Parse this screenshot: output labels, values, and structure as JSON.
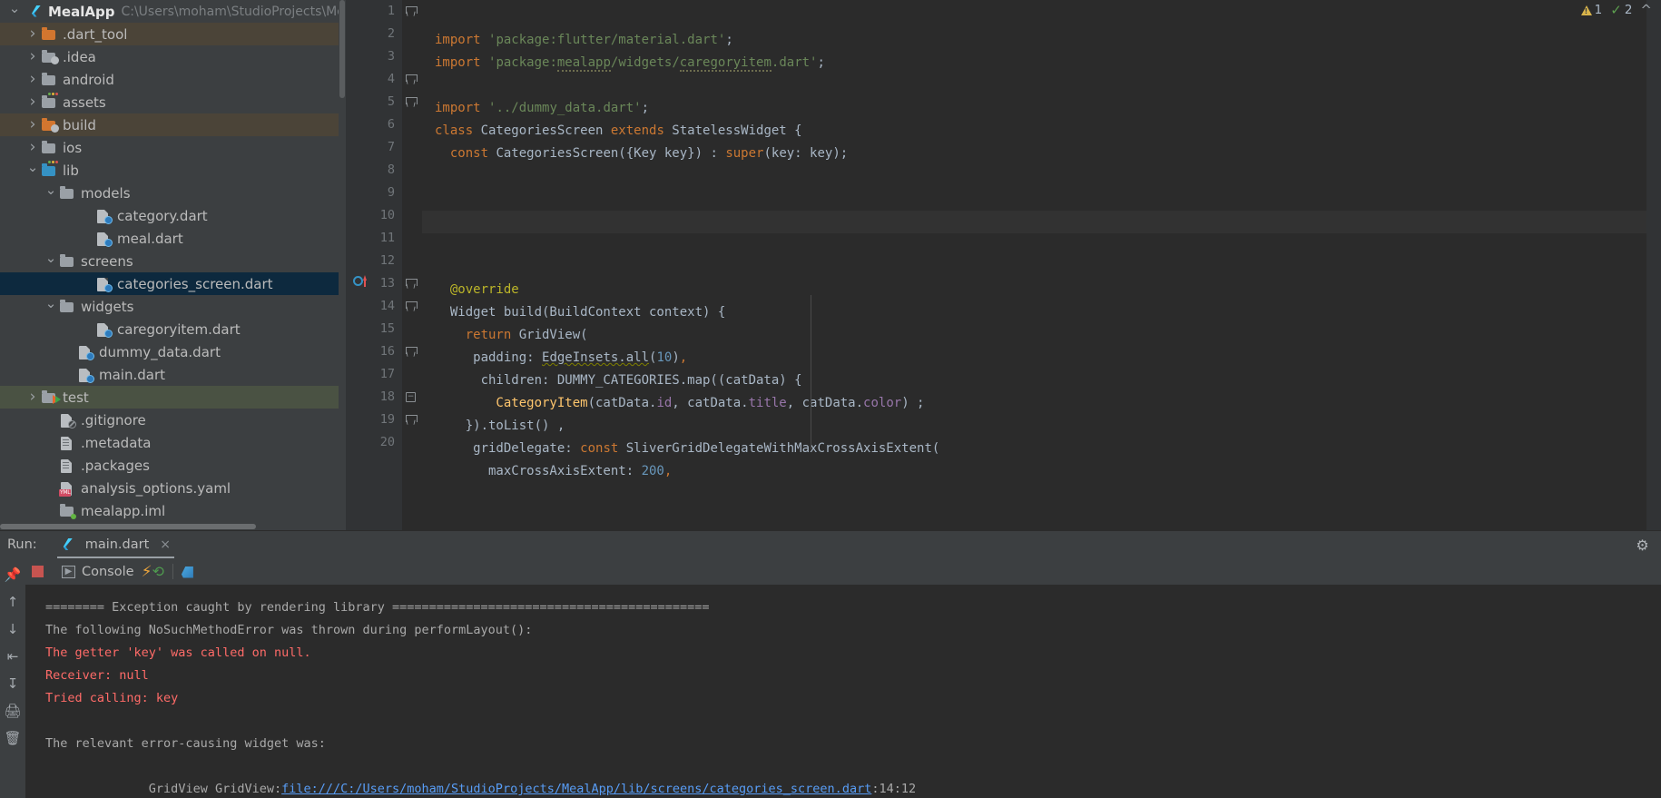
{
  "project": {
    "root_label": "MealApp",
    "root_path": "C:\\Users\\moham\\StudioProjects\\MealApp",
    "items": [
      {
        "label": ".dart_tool",
        "indent": 1,
        "arrow": "closed",
        "icon": "folder-orange",
        "row_style": "hl-orange"
      },
      {
        "label": ".idea",
        "indent": 1,
        "arrow": "closed",
        "icon": "folder-spin",
        "row_style": ""
      },
      {
        "label": "android",
        "indent": 1,
        "arrow": "closed",
        "icon": "folder-android",
        "row_style": ""
      },
      {
        "label": "assets",
        "indent": 1,
        "arrow": "closed",
        "icon": "folder-gray",
        "row_style": ""
      },
      {
        "label": "build",
        "indent": 1,
        "arrow": "closed",
        "icon": "folder-orange-spin",
        "row_style": "hl-orange"
      },
      {
        "label": "ios",
        "indent": 1,
        "arrow": "closed",
        "icon": "folder-android",
        "row_style": ""
      },
      {
        "label": "lib",
        "indent": 1,
        "arrow": "open",
        "icon": "folder-blue",
        "row_style": ""
      },
      {
        "label": "models",
        "indent": 2,
        "arrow": "open",
        "icon": "folder-gray",
        "row_style": ""
      },
      {
        "label": "category.dart",
        "indent": 4,
        "arrow": "none",
        "icon": "dart-file",
        "row_style": ""
      },
      {
        "label": "meal.dart",
        "indent": 4,
        "arrow": "none",
        "icon": "dart-file",
        "row_style": ""
      },
      {
        "label": "screens",
        "indent": 2,
        "arrow": "open",
        "icon": "folder-gray",
        "row_style": ""
      },
      {
        "label": "categories_screen.dart",
        "indent": 4,
        "arrow": "none",
        "icon": "dart-file",
        "row_style": "selected"
      },
      {
        "label": "widgets",
        "indent": 2,
        "arrow": "open",
        "icon": "folder-gray",
        "row_style": ""
      },
      {
        "label": "caregoryitem.dart",
        "indent": 4,
        "arrow": "none",
        "icon": "dart-file",
        "row_style": ""
      },
      {
        "label": "dummy_data.dart",
        "indent": 3,
        "arrow": "none",
        "icon": "dart-file",
        "row_style": ""
      },
      {
        "label": "main.dart",
        "indent": 3,
        "arrow": "none",
        "icon": "dart-file",
        "row_style": ""
      },
      {
        "label": "test",
        "indent": 1,
        "arrow": "closed",
        "icon": "folder-test",
        "row_style": "hl-green"
      },
      {
        "label": ".gitignore",
        "indent": 2,
        "arrow": "none",
        "icon": "gitignore-file",
        "row_style": ""
      },
      {
        "label": ".metadata",
        "indent": 2,
        "arrow": "none",
        "icon": "meta-file",
        "row_style": ""
      },
      {
        "label": ".packages",
        "indent": 2,
        "arrow": "none",
        "icon": "meta-file",
        "row_style": ""
      },
      {
        "label": "analysis_options.yaml",
        "indent": 2,
        "arrow": "none",
        "icon": "yaml-file",
        "row_style": ""
      },
      {
        "label": "mealapp.iml",
        "indent": 2,
        "arrow": "none",
        "icon": "iml-file",
        "row_style": ""
      }
    ]
  },
  "inspections": {
    "warning_count": "1",
    "ok_count": "2"
  },
  "editor": {
    "line_numbers": [
      "1",
      "2",
      "3",
      "4",
      "5",
      "6",
      "7",
      "8",
      "9",
      "10",
      "11",
      "12",
      "13",
      "14",
      "15",
      "16",
      "17",
      "18",
      "19",
      "20"
    ],
    "lines": [
      [
        {
          "t": "import ",
          "c": "kw"
        },
        {
          "t": "'package:flutter/material.dart'",
          "c": "str"
        },
        {
          "t": ";",
          "c": "def"
        }
      ],
      [
        {
          "t": "import ",
          "c": "kw"
        },
        {
          "t": "'package:",
          "c": "str"
        },
        {
          "t": "mealapp",
          "c": "str spell"
        },
        {
          "t": "/widgets/",
          "c": "str"
        },
        {
          "t": "caregoryitem",
          "c": "str spell"
        },
        {
          "t": ".dart'",
          "c": "str"
        },
        {
          "t": ";",
          "c": "def"
        }
      ],
      [],
      [
        {
          "t": "import ",
          "c": "kw"
        },
        {
          "t": "'../dummy_data.dart'",
          "c": "str"
        },
        {
          "t": ";",
          "c": "def"
        }
      ],
      [
        {
          "t": "class ",
          "c": "kw"
        },
        {
          "t": "CategoriesScreen",
          "c": "def"
        },
        {
          "t": " extends ",
          "c": "kw"
        },
        {
          "t": "StatelessWidget",
          "c": "def"
        },
        {
          "t": " {",
          "c": "def"
        }
      ],
      [
        {
          "t": "  const ",
          "c": "kw"
        },
        {
          "t": "CategoriesScreen({Key key}) : ",
          "c": "def"
        },
        {
          "t": "super",
          "c": "kw"
        },
        {
          "t": "(key: key);",
          "c": "def"
        }
      ],
      [],
      [],
      [],
      [],
      [],
      [
        {
          "t": "  @override",
          "c": "ann"
        }
      ],
      [
        {
          "t": "  Widget build(BuildContext context) {",
          "c": "def"
        }
      ],
      [
        {
          "t": "    return ",
          "c": "kw"
        },
        {
          "t": "GridView(",
          "c": "def"
        }
      ],
      [
        {
          "t": "     padding: ",
          "c": "def"
        },
        {
          "t": "EdgeInsets.all",
          "c": "def err-underline"
        },
        {
          "t": "(",
          "c": "def"
        },
        {
          "t": "10",
          "c": "num"
        },
        {
          "t": ")",
          "c": "def"
        },
        {
          "t": ",",
          "c": "red"
        }
      ],
      [
        {
          "t": "      children: DUMMY_CATEGORIES.map((catData) {",
          "c": "def"
        }
      ],
      [
        {
          "t": "        CategoryItem",
          "c": "fnc"
        },
        {
          "t": "(catData.",
          "c": "def"
        },
        {
          "t": "id",
          "c": "fld"
        },
        {
          "t": ", catData.",
          "c": "def"
        },
        {
          "t": "title",
          "c": "fld"
        },
        {
          "t": ", catData.",
          "c": "def"
        },
        {
          "t": "color",
          "c": "fld"
        },
        {
          "t": ") ;",
          "c": "def"
        }
      ],
      [
        {
          "t": "    }).toList() ,",
          "c": "def"
        }
      ],
      [
        {
          "t": "     gridDelegate: ",
          "c": "def"
        },
        {
          "t": "const ",
          "c": "kw"
        },
        {
          "t": "SliverGridDelegateWithMaxCrossAxisExtent(",
          "c": "def"
        }
      ],
      [
        {
          "t": "       maxCrossAxisExtent: ",
          "c": "def"
        },
        {
          "t": "200",
          "c": "num"
        },
        {
          "t": ",",
          "c": "red"
        }
      ]
    ]
  },
  "run_panel": {
    "run_label": "Run:",
    "tab_label": "main.dart",
    "tab_close": "×",
    "gear_icon": "gear-icon",
    "console_tab_label": "Console",
    "console_output": [
      {
        "text": "======== Exception caught by rendering library ===========================================",
        "style": "gray"
      },
      {
        "text": "The following NoSuchMethodError was thrown during performLayout():",
        "style": "gray"
      },
      {
        "text": "The getter 'key' was called on null.",
        "style": "red"
      },
      {
        "text": "Receiver: null",
        "style": "red"
      },
      {
        "text": "Tried calling: key",
        "style": "red"
      },
      {
        "text": "",
        "style": "gray"
      },
      {
        "text": "The relevant error-causing widget was:",
        "style": "gray"
      }
    ],
    "last_line": {
      "prefix": "  GridView GridView:",
      "link": "file:///C:/Users/moham/StudioProjects/MealApp/lib/screens/categories_screen.dart",
      "suffix": ":14:12"
    }
  },
  "colors": {
    "background": "#3c3f41",
    "editor_bg": "#2b2b2b",
    "selection": "#0d293e",
    "error_red": "#ff6b68",
    "link_blue": "#589df6",
    "accent_orange": "#cc7832"
  }
}
